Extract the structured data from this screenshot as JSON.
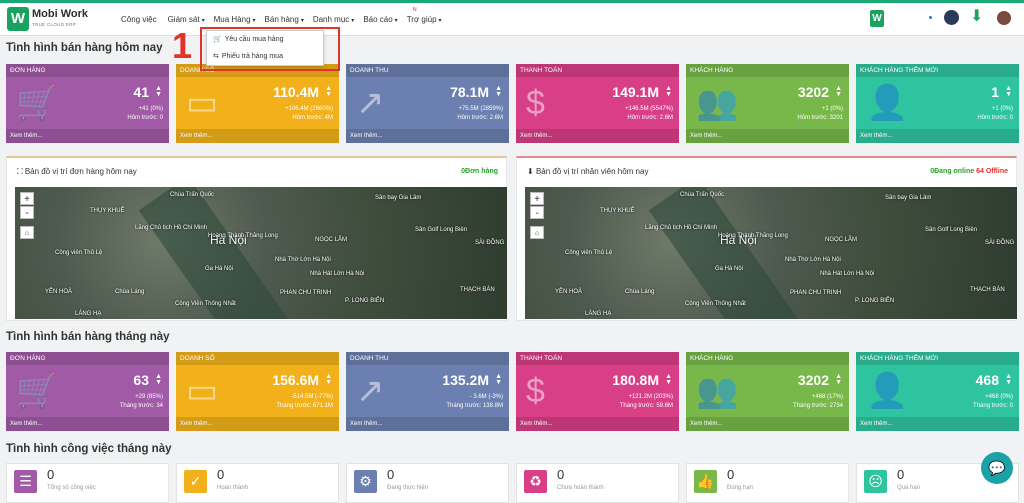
{
  "brand": {
    "name": "Mobi Work",
    "tagline": "TRUE CLOUD ERP",
    "logo_letter": "W"
  },
  "menu": {
    "items": [
      {
        "label": "Công việc",
        "caret": ""
      },
      {
        "label": "Giám sát",
        "caret": "▾"
      },
      {
        "label": "Mua Hàng",
        "caret": "▾"
      },
      {
        "label": "Bán hàng",
        "caret": "▾"
      },
      {
        "label": "Danh mục",
        "caret": "▾"
      },
      {
        "label": "Báo cáo",
        "caret": "▾"
      },
      {
        "label": "Trợ giúp",
        "caret": "▾"
      }
    ],
    "new_badge": "N"
  },
  "dropdown": {
    "items": [
      {
        "label": "Yêu cầu mua hàng",
        "icon": "cart-icon"
      },
      {
        "label": "Phiếu trả hàng mua",
        "icon": "return-icon"
      }
    ]
  },
  "annotation": {
    "number": "1"
  },
  "today": {
    "title": "Tình hình bán hàng hôm nay",
    "cards": [
      {
        "head": "ĐƠN HÀNG",
        "value": "41",
        "delta": "+41 (0%)",
        "prev": "Hôm trước: 0",
        "foot": "Xem thêm...",
        "color": "#a05aa6",
        "icon": "cart-icon"
      },
      {
        "head": "DOANH SỐ",
        "value": "110.4M",
        "delta": "+106.4M (2660%)",
        "prev": "Hôm trước: 4M",
        "foot": "Xem thêm...",
        "color": "#f2b11a",
        "icon": "card-icon"
      },
      {
        "head": "DOANH THU",
        "value": "78.1M",
        "delta": "+75.5M (2859%)",
        "prev": "Hôm trước: 2.6M",
        "foot": "Xem thêm...",
        "color": "#6b7fb0",
        "icon": "chart-icon"
      },
      {
        "head": "THANH TOÁN",
        "value": "149.1M",
        "delta": "+146.5M (5547%)",
        "prev": "Hôm trước: 2.6M",
        "foot": "Xem thêm...",
        "color": "#d83f87",
        "icon": "dollar-icon"
      },
      {
        "head": "KHÁCH HÀNG",
        "value": "3202",
        "delta": "+1 (0%)",
        "prev": "Hôm trước: 3201",
        "foot": "Xem thêm...",
        "color": "#78b84a",
        "icon": "users-icon"
      },
      {
        "head": "KHÁCH HÀNG THÊM MỚI",
        "value": "1",
        "delta": "+1 (0%)",
        "prev": "Hôm trước: 0",
        "foot": "Xem thêm...",
        "color": "#2ec4a0",
        "icon": "user-add-icon"
      }
    ]
  },
  "maps": {
    "left": {
      "title": "Bản đồ vị trí đơn hàng hôm nay",
      "right": "0Đơn hàng"
    },
    "right": {
      "title": "Bản đồ vị trí nhân viên hôm nay",
      "online": "0Đang online",
      "offline": "64 Offline"
    },
    "labels": [
      "Hà Nội",
      "Chùa Trấn Quốc",
      "THỤY KHUÊ",
      "Lăng Chủ tịch Hồ Chí Minh",
      "Hoàng Thành Thăng Long",
      "Nhà Thờ Lớn Hà Nội",
      "Nhà Hát Lớn Hà Nội",
      "PHAN CHU TRINH",
      "THẠCH BÀN",
      "YÊN HOÀ",
      "Chùa Láng",
      "Công Viên Thống Nhất",
      "P. LONG BIÊN",
      "SÀI ĐỒNG",
      "Sân bay Gia Lâm",
      "NGỌC LÂM",
      "Sân Golf Long Biên",
      "Ga Hà Nội",
      "Công viên Thủ Lệ",
      "LÁNG HẠ"
    ],
    "zoom_in": "+",
    "zoom_out": "-"
  },
  "month": {
    "title": "Tình hình bán hàng tháng này",
    "cards": [
      {
        "head": "ĐƠN HÀNG",
        "value": "63",
        "delta": "+29 (85%)",
        "prev": "Tháng trước: 34",
        "foot": "Xem thêm...",
        "color": "#a05aa6",
        "icon": "cart-icon"
      },
      {
        "head": "DOANH SỐ",
        "value": "156.6M",
        "delta": "-514.5M (-77%)",
        "prev": "Tháng trước: 671.1M",
        "foot": "Xem thêm...",
        "color": "#f2b11a",
        "icon": "card-icon"
      },
      {
        "head": "DOANH THU",
        "value": "135.2M",
        "delta": "- 3.6M (-3%)",
        "prev": "Tháng trước: 138.8M",
        "foot": "Xem thêm...",
        "color": "#6b7fb0",
        "icon": "chart-icon"
      },
      {
        "head": "THANH TOÁN",
        "value": "180.8M",
        "delta": "+121.2M (203%)",
        "prev": "Tháng trước: 59.6M",
        "foot": "Xem thêm...",
        "color": "#d83f87",
        "icon": "dollar-icon"
      },
      {
        "head": "KHÁCH HÀNG",
        "value": "3202",
        "delta": "+468 (17%)",
        "prev": "Tháng trước: 2734",
        "foot": "Xem thêm...",
        "color": "#78b84a",
        "icon": "users-icon"
      },
      {
        "head": "KHÁCH HÀNG THÊM MỚI",
        "value": "468",
        "delta": "+468 (0%)",
        "prev": "Tháng trước: 0",
        "foot": "Xem thêm...",
        "color": "#2ec4a0",
        "icon": "user-add-icon"
      }
    ]
  },
  "work": {
    "title": "Tình hình công việc tháng này",
    "stats": [
      {
        "value": "0",
        "label": "Tổng số công việc",
        "color": "#a05aa6",
        "icon": "list-icon"
      },
      {
        "value": "0",
        "label": "Hoàn thành",
        "color": "#f2b11a",
        "icon": "calendar-check-icon"
      },
      {
        "value": "0",
        "label": "Đang thực hiện",
        "color": "#6b7fb0",
        "icon": "gears-icon"
      },
      {
        "value": "0",
        "label": "Chưa hoàn thành",
        "color": "#d83f87",
        "icon": "recycle-icon"
      },
      {
        "value": "0",
        "label": "Đúng hạn",
        "color": "#78b84a",
        "icon": "thumbs-up-icon"
      },
      {
        "value": "0",
        "label": "Quá hạn",
        "color": "#2ec4a0",
        "icon": "sad-icon"
      }
    ]
  }
}
